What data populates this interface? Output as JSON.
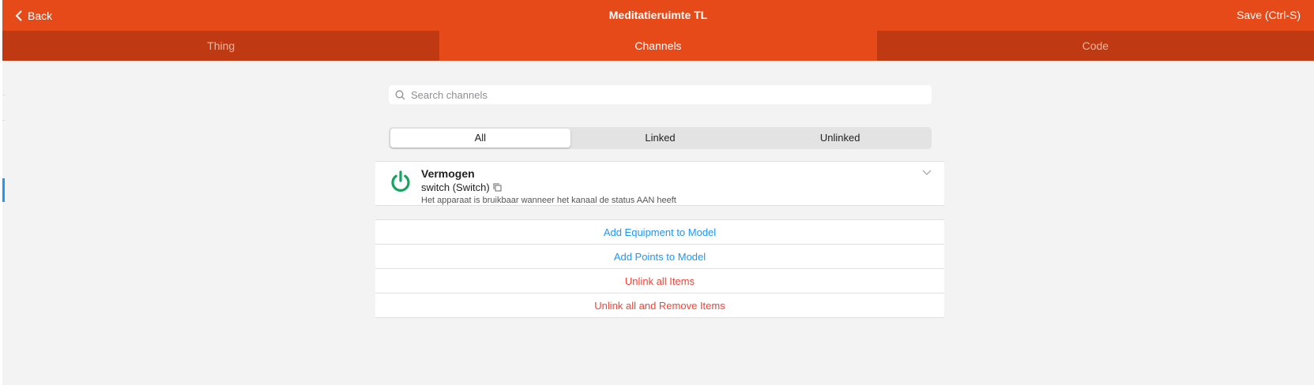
{
  "navbar": {
    "back_label": "Back",
    "title": "Meditatieruimte TL",
    "save_label": "Save (Ctrl-S)",
    "color": "#e64a19"
  },
  "tabs": [
    {
      "label": "Thing",
      "active": false
    },
    {
      "label": "Channels",
      "active": true
    },
    {
      "label": "Code",
      "active": false
    }
  ],
  "search": {
    "placeholder": "Search channels",
    "value": ""
  },
  "filter": {
    "options": [
      "All",
      "Linked",
      "Unlinked"
    ],
    "selected": "All"
  },
  "channels": [
    {
      "label": "Vermogen",
      "type": "switch (Switch)",
      "description": "Het apparaat is bruikbaar wanneer het kanaal de status AAN heeft",
      "icon": "power-icon",
      "icon_color": "#1aa260"
    }
  ],
  "actions": [
    {
      "label": "Add Equipment to Model",
      "color": "#2196f3"
    },
    {
      "label": "Add Points to Model",
      "color": "#2196f3"
    },
    {
      "label": "Unlink all Items",
      "color": "#f44336"
    },
    {
      "label": "Unlink all and Remove Items",
      "color": "#f44336"
    }
  ]
}
